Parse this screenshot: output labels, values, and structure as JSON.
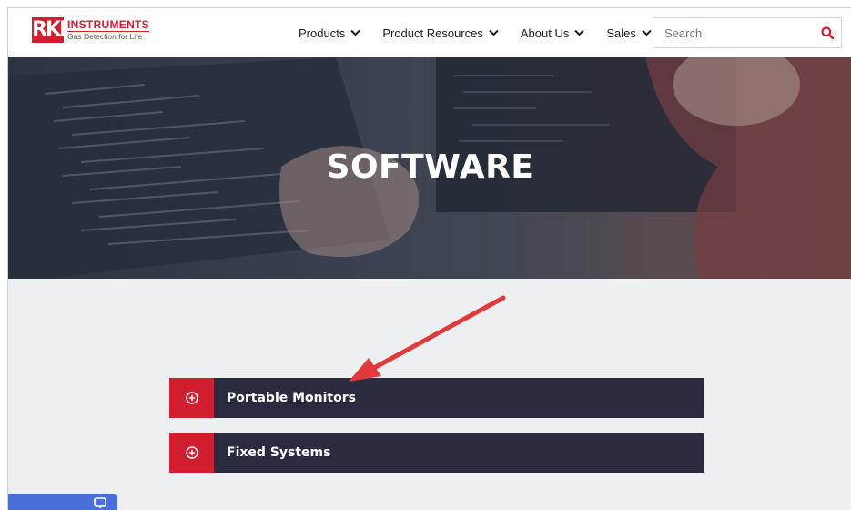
{
  "brand": {
    "logo_mark": "RKI",
    "name": "INSTRUMENTS",
    "tagline": "Gas Detection for Life",
    "accent": "#d11f2f"
  },
  "nav": {
    "items": [
      {
        "label": "Products"
      },
      {
        "label": "Product Resources"
      },
      {
        "label": "About Us"
      },
      {
        "label": "Sales"
      }
    ]
  },
  "search": {
    "placeholder": "Search",
    "icon": "search-icon"
  },
  "hero": {
    "title": "SOFTWARE"
  },
  "accordion": {
    "items": [
      {
        "label": "Portable Monitors",
        "icon": "plus-circle-icon"
      },
      {
        "label": "Fixed Systems",
        "icon": "plus-circle-icon"
      }
    ],
    "bar_color": "#2a2b3f"
  },
  "chat": {
    "icon": "chat-bubble-icon",
    "color": "#4a6fd8"
  }
}
